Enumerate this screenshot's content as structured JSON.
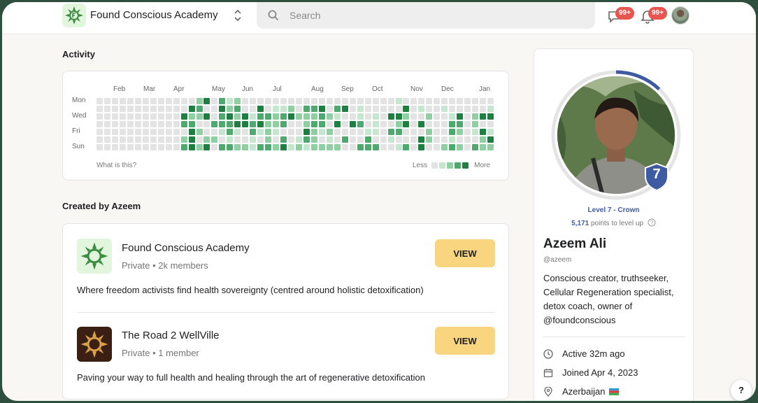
{
  "header": {
    "brand": "Found Conscious Academy",
    "search_placeholder": "Search",
    "chat_badge": "99+",
    "notif_badge": "99+"
  },
  "activity": {
    "title": "Activity",
    "months": [
      "Feb",
      "Mar",
      "Apr",
      "May",
      "Jun",
      "Jul",
      "Aug",
      "Sep",
      "Oct",
      "Nov",
      "Dec",
      "Jan"
    ],
    "days": [
      "Mon",
      "Wed",
      "Fri",
      "Sun"
    ],
    "what_link": "What is this?",
    "less": "Less",
    "more": "More",
    "colors": [
      "#e3e3e3",
      "#c6e7cf",
      "#8fd0a2",
      "#4fa86d",
      "#1f7f43"
    ],
    "weeks": 52,
    "levels": [
      "0000000000000240312000000000000000000001000000000000",
      "0000000000004300423004011203340340100000401001000001",
      "0000000000042240342413323422232100101044200200140244",
      "0000000000033003334434223002330404301002404000330200",
      "0000000000004200131031210004212000011033000200320141",
      "0000000000024022010010203013201030030010004200100024",
      "0000000000034240332213324121222200333001304002320322"
    ]
  },
  "created": {
    "title": "Created by Azeem",
    "groups": [
      {
        "name": "Found Conscious Academy",
        "meta": "Private • 2k members",
        "desc": "Where freedom activists find health sovereignty (centred around holistic detoxification)",
        "button": "VIEW"
      },
      {
        "name": "The Road 2 WellVille",
        "meta": "Private • 1 member",
        "desc": "Paving your way to full health and healing through the art of regenerative detoxification",
        "button": "VIEW"
      }
    ]
  },
  "profile": {
    "level_badge": "7",
    "level_text": "Level 7 - Crown",
    "points": "5,171",
    "points_suffix": " points to level up",
    "level_progress": 0.12,
    "name": "Azeem Ali",
    "handle": "@azeem",
    "bio": "Conscious creator, truthseeker, Cellular Regeneration specialist, detox coach, owner of @foundconscious",
    "active": "Active 32m ago",
    "joined": "Joined Apr 4, 2023",
    "location": "Azerbaijan"
  },
  "help": "?"
}
